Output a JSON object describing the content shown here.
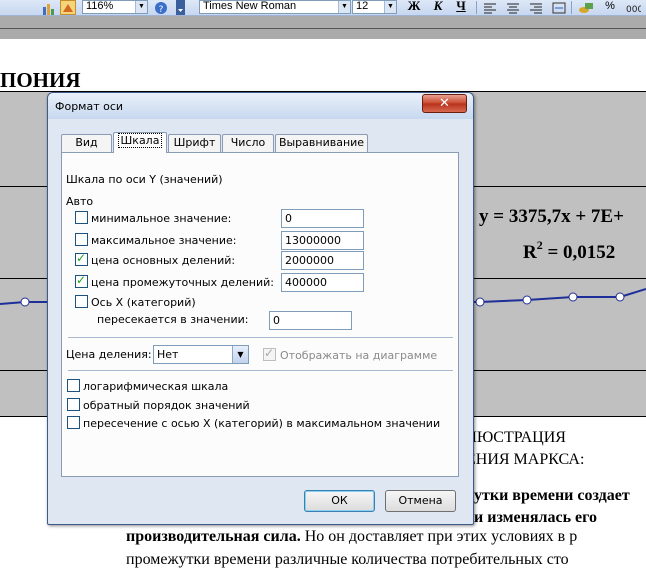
{
  "toolbar": {
    "zoom": "116%",
    "font_name": "Times New Roman",
    "font_size": "12",
    "bold": "Ж",
    "italic": "К",
    "underline": "Ч"
  },
  "document": {
    "chapter_title": "ПОНИЯ",
    "trend_equation": "y = 3375,7x + 7E+",
    "r2_base": "R",
    "r2_exp": "2",
    "r2_value": " = 0,0152",
    "line1": "ЛЮСТРАЦИЯ",
    "line2": "ЕНИЯ МАРКСА:",
    "line3": "утки времени создает",
    "line4": "и изменялась его",
    "line5_bold": "производительная сила.",
    "line5_rest": " Но он доставляет при этих условиях в р",
    "line6": "промежутки времени различные количества потребительных сто"
  },
  "dialog": {
    "title": "Формат оси",
    "close_glyph": "✕",
    "tabs": [
      {
        "label": "Вид"
      },
      {
        "label": "Шкала"
      },
      {
        "label": "Шрифт"
      },
      {
        "label": "Число"
      },
      {
        "label": "Выравнивание"
      }
    ],
    "axis_heading": "Шкала по оси Y (значений)",
    "auto_heading": "Авто",
    "rows": [
      {
        "label": "минимальное значение:",
        "value": "0",
        "checked": false
      },
      {
        "label": "максимальное значение:",
        "value": "13000000",
        "checked": false
      },
      {
        "label": "цена основных делений:",
        "value": "2000000",
        "checked": true
      },
      {
        "label": "цена промежуточных делений:",
        "value": "400000",
        "checked": true
      }
    ],
    "cross_label": "Ось X (категорий)",
    "cross_sub": "пересекается в значении:",
    "cross_value": "0",
    "units_label": "Цена деления:",
    "units_value": "Нет",
    "display_on_chart": "Отображать на диаграмме",
    "options": [
      {
        "label": "логарифмическая шкала"
      },
      {
        "label": "обратный порядок значений"
      },
      {
        "label": "пересечение с осью X (категорий) в максимальном значении"
      }
    ],
    "ok": "ОК",
    "cancel": "Отмена"
  }
}
